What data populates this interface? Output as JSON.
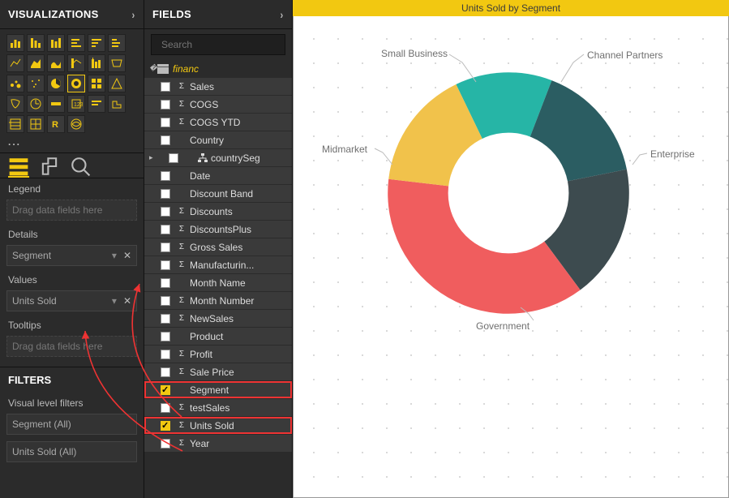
{
  "viz": {
    "header": "VISUALIZATIONS",
    "more": "...",
    "sections": {
      "legend": "Legend",
      "legend_ph": "Drag data fields here",
      "details": "Details",
      "details_field": "Segment",
      "values": "Values",
      "values_field": "Units Sold",
      "tooltips": "Tooltips",
      "tooltips_ph": "Drag data fields here"
    },
    "filters_hdr": "FILTERS",
    "visual_filters": "Visual level filters",
    "filter1": "Segment (All)",
    "filter2": "Units Sold (All)"
  },
  "fields": {
    "header": "FIELDS",
    "search_ph": "Search",
    "table": "financ",
    "items": [
      {
        "label": "Sales",
        "sigma": true,
        "checked": false
      },
      {
        "label": "COGS",
        "sigma": true,
        "checked": false
      },
      {
        "label": "COGS YTD",
        "sigma": true,
        "checked": false
      },
      {
        "label": "Country",
        "sigma": false,
        "checked": false
      },
      {
        "label": "countrySeg",
        "sigma": false,
        "checked": false,
        "hier": true
      },
      {
        "label": "Date",
        "sigma": false,
        "checked": false
      },
      {
        "label": "Discount Band",
        "sigma": false,
        "checked": false
      },
      {
        "label": "Discounts",
        "sigma": true,
        "checked": false
      },
      {
        "label": "DiscountsPlus",
        "sigma": true,
        "checked": false
      },
      {
        "label": "Gross Sales",
        "sigma": true,
        "checked": false
      },
      {
        "label": "Manufacturin...",
        "sigma": true,
        "checked": false
      },
      {
        "label": "Month Name",
        "sigma": false,
        "checked": false
      },
      {
        "label": "Month Number",
        "sigma": true,
        "checked": false
      },
      {
        "label": "NewSales",
        "sigma": true,
        "checked": false
      },
      {
        "label": "Product",
        "sigma": false,
        "checked": false
      },
      {
        "label": "Profit",
        "sigma": true,
        "checked": false
      },
      {
        "label": "Sale Price",
        "sigma": true,
        "checked": false
      },
      {
        "label": "Segment",
        "sigma": false,
        "checked": true,
        "highlight": true
      },
      {
        "label": "testSales",
        "sigma": true,
        "checked": false
      },
      {
        "label": "Units Sold",
        "sigma": true,
        "checked": true,
        "highlight": true
      },
      {
        "label": "Year",
        "sigma": true,
        "checked": false
      }
    ]
  },
  "chart": {
    "title": "Units Sold by Segment",
    "labels": {
      "sb": "Small Business",
      "cp": "Channel Partners",
      "ent": "Enterprise",
      "gov": "Government",
      "mm": "Midmarket"
    }
  },
  "chart_data": {
    "type": "pie",
    "title": "Units Sold by Segment",
    "categories": [
      "Small Business",
      "Channel Partners",
      "Enterprise",
      "Government",
      "Midmarket"
    ],
    "values": [
      13,
      16,
      18,
      37,
      16
    ],
    "colors": [
      "#26b5a6",
      "#2b5d62",
      "#3d4b4f",
      "#f05d5e",
      "#f1c24b"
    ],
    "note": "values estimated from slice arc proportions; donut chart (inner radius ~50%)"
  }
}
